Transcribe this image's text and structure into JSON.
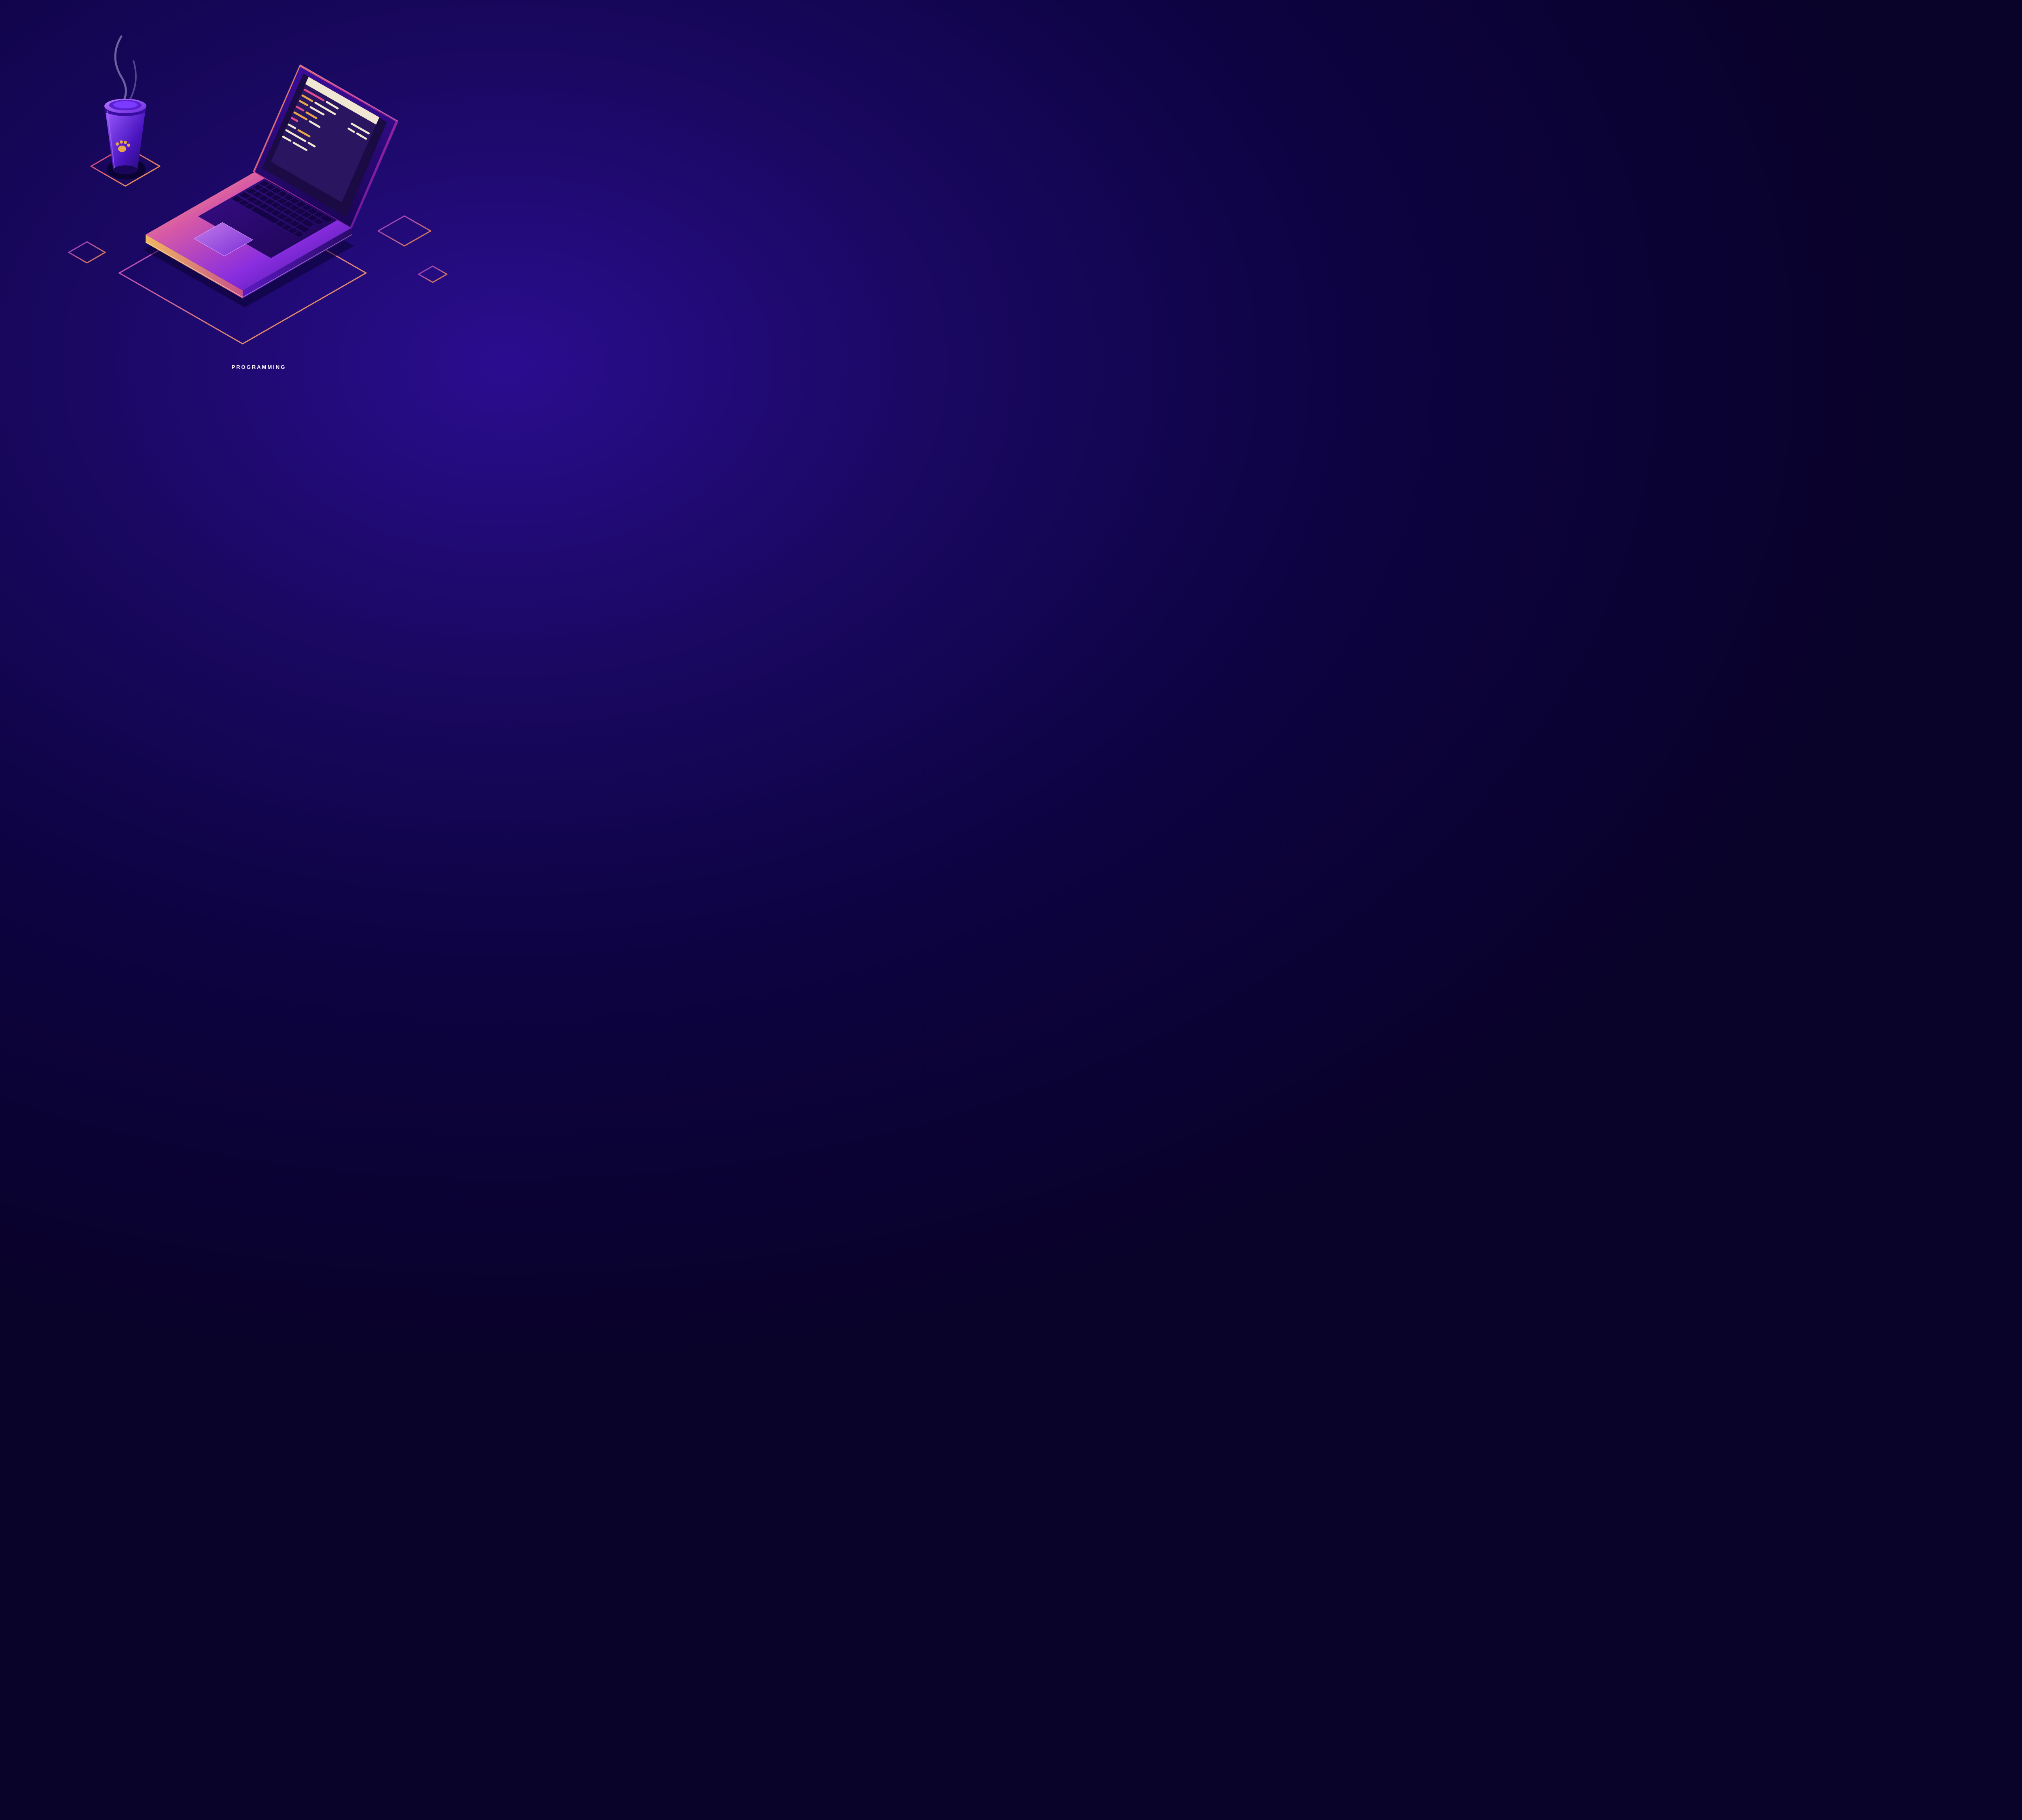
{
  "caption": "PROGRAMMING",
  "scene": {
    "description": "Isometric neon illustration of a laptop with code on screen and a coffee cup",
    "elements": [
      "laptop",
      "coffee-cup",
      "floor-tiles",
      "code-editor"
    ]
  },
  "colors": {
    "bg_deep": "#090229",
    "bg_mid": "#1a0862",
    "neon_orange": "#f2a24a",
    "neon_pink": "#c9368e",
    "neon_purple": "#7a2ff0",
    "violet_light": "#9d5cff",
    "violet_dark": "#2a0a6a",
    "screen_bg": "#1b0b44",
    "code_cream": "#f0e6d2",
    "code_amber": "#e8a84a",
    "code_pink": "#e84a8e"
  }
}
